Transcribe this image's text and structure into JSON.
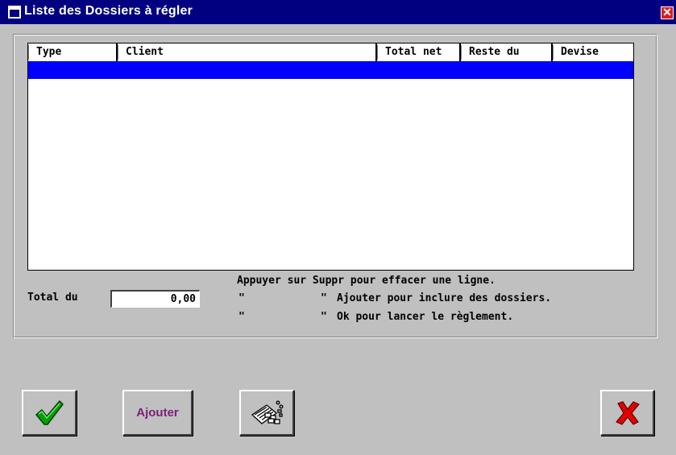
{
  "window": {
    "title": "Liste des Dossiers à régler",
    "title_icon": "window-icon",
    "close_icon": "close-icon",
    "close_glyph": "✕"
  },
  "table": {
    "columns": [
      {
        "label": "Type"
      },
      {
        "label": "Client"
      },
      {
        "label": "Total net"
      },
      {
        "label": "Reste du"
      },
      {
        "label": "Devise"
      }
    ],
    "rows": [],
    "selection_color": "#0000ff"
  },
  "total": {
    "label": "Total du",
    "value": "0,00"
  },
  "hints": {
    "line1": "Appuyer sur Suppr pour effacer une ligne.",
    "line2_quote1": "\"",
    "line2_quote2": "\"",
    "line2_text": "Ajouter pour inclure des dossiers.",
    "line3_quote1": "\"",
    "line3_quote2": "\"",
    "line3_text": "Ok pour lancer le règlement."
  },
  "buttons": {
    "ok_icon": "checkmark-icon",
    "ajouter_label": "Ajouter",
    "list_icon": "document-list-icon",
    "cancel_icon": "red-x-icon"
  },
  "colors": {
    "titlebar": "#000080",
    "background": "#c0c0c0",
    "ajouter_text": "#7a1f7a",
    "check_green": "#00a000",
    "cancel_red": "#e00000"
  }
}
